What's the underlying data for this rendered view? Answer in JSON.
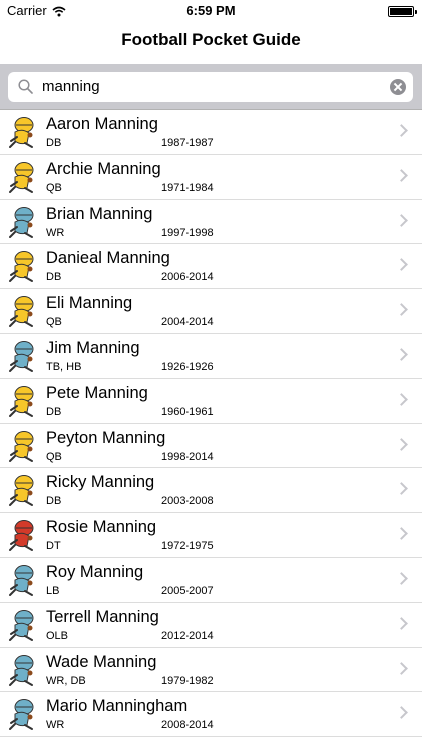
{
  "status_bar": {
    "carrier": "Carrier",
    "time": "6:59 PM"
  },
  "nav": {
    "title": "Football Pocket Guide"
  },
  "search": {
    "value": "manning"
  },
  "colors": {
    "yellow": "#f7c62a",
    "blue": "#6fb0c8",
    "red": "#d23a2a"
  },
  "players": [
    {
      "name": "Aaron Manning",
      "position": "DB",
      "years": "1987-1987",
      "icon": "db-mascot-icon"
    },
    {
      "name": "Archie Manning",
      "position": "QB",
      "years": "1971-1984",
      "icon": "qb-mascot-icon"
    },
    {
      "name": "Brian Manning",
      "position": "WR",
      "years": "1997-1998",
      "icon": "wr-mascot-icon"
    },
    {
      "name": "Danieal Manning",
      "position": "DB",
      "years": "2006-2014",
      "icon": "db-mascot-icon"
    },
    {
      "name": "Eli Manning",
      "position": "QB",
      "years": "2004-2014",
      "icon": "qb-mascot-icon"
    },
    {
      "name": "Jim Manning",
      "position": "TB, HB",
      "years": "1926-1926",
      "icon": "rb-mascot-icon"
    },
    {
      "name": "Pete Manning",
      "position": "DB",
      "years": "1960-1961",
      "icon": "db-mascot-icon"
    },
    {
      "name": "Peyton Manning",
      "position": "QB",
      "years": "1998-2014",
      "icon": "qb-mascot-icon"
    },
    {
      "name": "Ricky Manning",
      "position": "DB",
      "years": "2003-2008",
      "icon": "db-mascot-icon"
    },
    {
      "name": "Rosie Manning",
      "position": "DT",
      "years": "1972-1975",
      "icon": "dt-mascot-icon"
    },
    {
      "name": "Roy Manning",
      "position": "LB",
      "years": "2005-2007",
      "icon": "lb-mascot-icon"
    },
    {
      "name": "Terrell Manning",
      "position": "OLB",
      "years": "2012-2014",
      "icon": "lb-mascot-icon"
    },
    {
      "name": "Wade Manning",
      "position": "WR, DB",
      "years": "1979-1982",
      "icon": "wr-mascot-icon"
    },
    {
      "name": "Mario Manningham",
      "position": "WR",
      "years": "2008-2014",
      "icon": "wr-mascot-icon"
    }
  ]
}
